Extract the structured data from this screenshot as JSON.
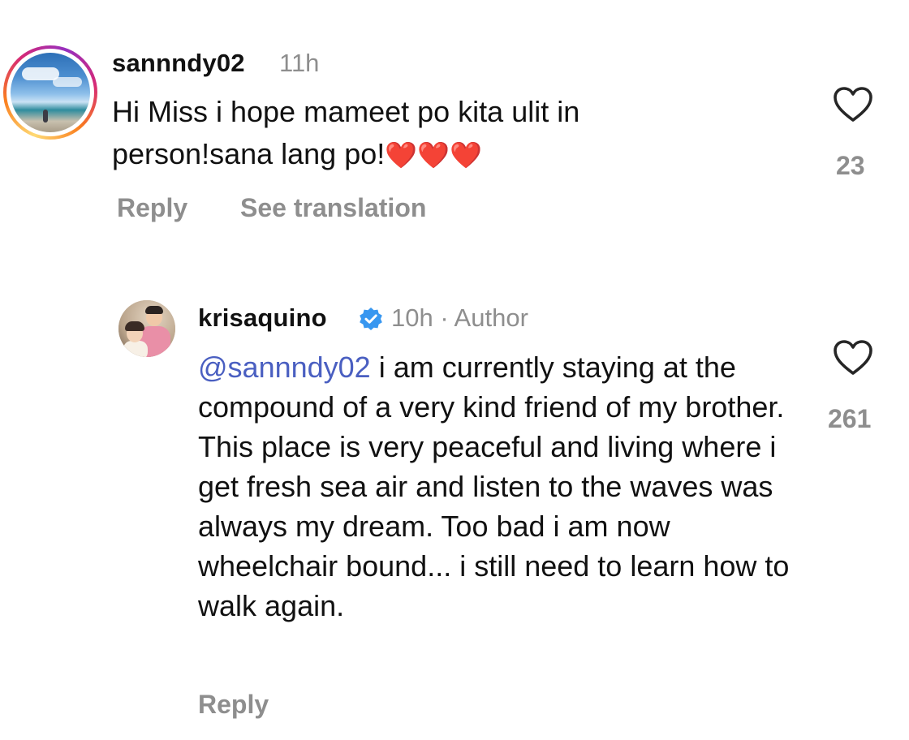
{
  "comments": [
    {
      "username": "sannndy02",
      "time": "11h",
      "text": "Hi Miss i hope mameet po kita ulit in person!sana lang po!",
      "emoji": "❤️❤️❤️",
      "likes": "23",
      "reply_label": "Reply",
      "translation_label": "See translation"
    },
    {
      "username": "krisaquino",
      "time": "10h · Author",
      "mention": "@sannndy02",
      "text": "i am currently staying at the compound of a very kind friend of my brother. This place is very peaceful and living where i get fresh sea air and listen to the waves was always my dream. Too bad i am now wheelchair bound... i still need to learn how to walk again.",
      "likes": "261",
      "reply_label": "Reply"
    }
  ],
  "colors": {
    "secondary_text": "#8e8e8e",
    "mention": "#4a5fc1",
    "verified_badge": "#3897f0",
    "heart_emoji": "#ef1d1d"
  },
  "icons": {
    "like": "heart-outline-icon",
    "verified": "verified-badge-icon"
  }
}
